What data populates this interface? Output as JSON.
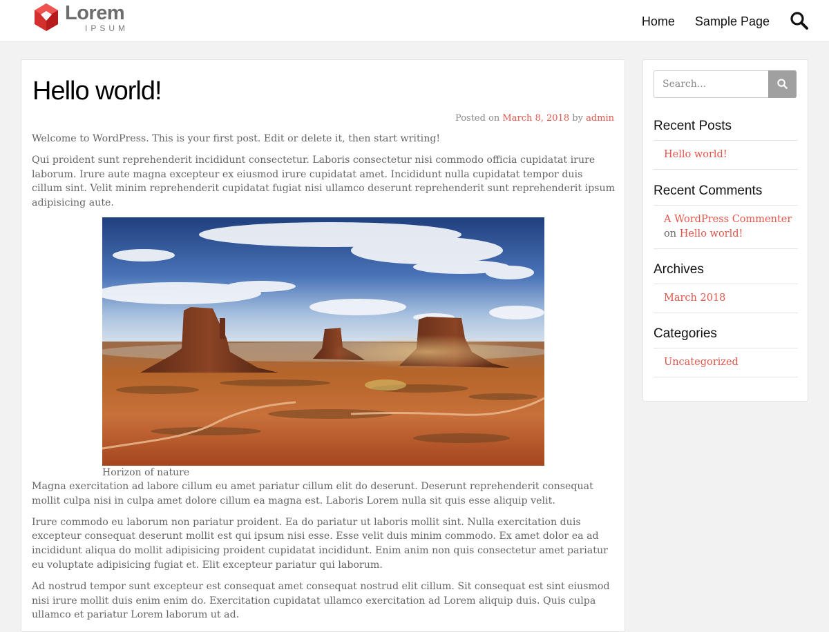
{
  "header": {
    "logo_word": "Lorem",
    "logo_sub": "IPSUM",
    "logo_colors": [
      "#e53935",
      "#c62828",
      "#ff6f61"
    ],
    "nav": [
      "Home",
      "Sample Page"
    ],
    "search_icon": "search-icon"
  },
  "post": {
    "title": "Hello world!",
    "meta": {
      "posted_on": "Posted on",
      "date": "March 8, 2018",
      "by": "by",
      "author": "admin"
    },
    "paragraphs_before": [
      "Welcome to WordPress. This is your first post. Edit or delete it, then start writing!",
      "Qui proident sunt reprehenderit incididunt consectetur. Laboris consectetur nisi commodo officia cupidatat irure laborum. Irure aute magna excepteur ex eiusmod irure cupidatat amet. Incididunt nulla cupidatat tempor duis cillum sint. Velit minim reprehenderit cupidatat fugiat nisi ullamco deserunt reprehenderit sunt reprehenderit ipsum adipisicing aute."
    ],
    "image": {
      "subject": "desert landscape with rock buttes under a cloudy blue sky",
      "caption": "Horizon of nature"
    },
    "paragraphs_after": [
      "Magna exercitation ad labore cillum eu amet pariatur cillum elit do deserunt. Deserunt reprehenderit consequat mollit culpa nisi in culpa amet dolore cillum ea magna est. Laboris Lorem nulla sit quis esse aliquip velit.",
      "Irure commodo eu laborum non pariatur proident. Ea do pariatur ut laboris mollit sint. Nulla exercitation duis excepteur consequat deserunt mollit est qui ipsum nisi esse. Esse velit duis minim commodo. Ex amet dolor ea ad incididunt aliqua do mollit adipisicing proident cupidatat incididunt. Enim anim non quis consectetur amet pariatur eu voluptate adipisicing fugiat et. Elit excepteur pariatur qui laborum.",
      "Ad nostrud tempor sunt excepteur est consequat amet consequat nostrud elit cillum. Sit consequat est sint eiusmod nisi irure mollit duis enim enim do. Exercitation cupidatat ullamco exercitation ad Lorem aliquip duis. Quis culpa ullamco et pariatur Lorem laborum ut ad."
    ]
  },
  "sidebar": {
    "search": {
      "placeholder": "Search...",
      "button_icon": "search-icon"
    },
    "recent_posts": {
      "title": "Recent Posts",
      "items": [
        "Hello world!"
      ]
    },
    "recent_comments": {
      "title": "Recent Comments",
      "items": [
        {
          "author": "A WordPress Commenter",
          "on": "on",
          "post": "Hello world!"
        }
      ]
    },
    "archives": {
      "title": "Archives",
      "items": [
        "March 2018"
      ]
    },
    "categories": {
      "title": "Categories",
      "items": [
        "Uncategorized"
      ]
    }
  },
  "colors": {
    "accent": "#e2554a",
    "background": "#f2f2f2",
    "search_button": "#a0a0a0"
  }
}
